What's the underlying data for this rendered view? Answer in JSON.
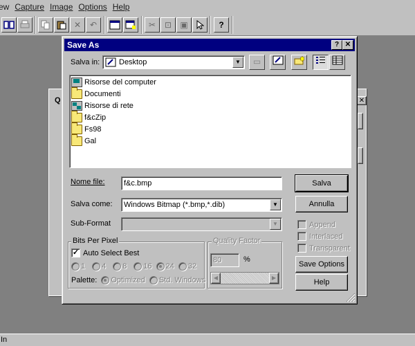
{
  "menu": [
    "ew",
    "Capture",
    "Image",
    "Options",
    "Help"
  ],
  "toolbar": {
    "icons": [
      "open-book-icon",
      "print-icon",
      "copy-icon",
      "paste-icon",
      "close-icon",
      "undo-icon",
      "window-icon",
      "new-window-icon",
      "cut-icon",
      "crop-icon",
      "resize-icon",
      "pointer-icon",
      "help-icon"
    ]
  },
  "dialog": {
    "title": "Save As",
    "help_btn": "?",
    "close_btn": "✕",
    "save_in_label": "Salva in:",
    "save_in_value": "Desktop",
    "files": [
      {
        "name": "Risorse del computer",
        "icon": "computer-icon"
      },
      {
        "name": "Documenti",
        "icon": "folder-icon"
      },
      {
        "name": "Risorse di rete",
        "icon": "network-icon"
      },
      {
        "name": "f&cZip",
        "icon": "folder-icon"
      },
      {
        "name": "Fs98",
        "icon": "folder-icon"
      },
      {
        "name": "Gal",
        "icon": "folder-icon"
      }
    ],
    "filename_label": "Nome file:",
    "filename_value": "f&c.bmp",
    "filetype_label": "Salva come:",
    "filetype_value": "Windows Bitmap (*.bmp,*.dib)",
    "subformat_label": "Sub-Format",
    "subformat_value": "",
    "save_btn": "Salva",
    "cancel_btn": "Annulla",
    "save_options_btn": "Save Options",
    "help_button": "Help",
    "append_label": "Append",
    "interlaced_label": "Interlaced",
    "transparent_label": "Transparent",
    "bpp": {
      "title": "Bits Per Pixel",
      "auto_label": "Auto Select Best",
      "auto_checked": true,
      "options": [
        "1",
        "4",
        "8",
        "16",
        "24",
        "32"
      ],
      "selected": "24",
      "palette_label": "Palette:",
      "palette_options": [
        "Optimized",
        "Std. Windows"
      ],
      "palette_selected": "Optimized"
    },
    "quality": {
      "title": "Quality Factor",
      "value": "80",
      "unit": "%"
    }
  },
  "statusbar": {
    "text": "In"
  },
  "bg_dialog": {
    "title_fragment": "Q",
    "close": "✕"
  }
}
